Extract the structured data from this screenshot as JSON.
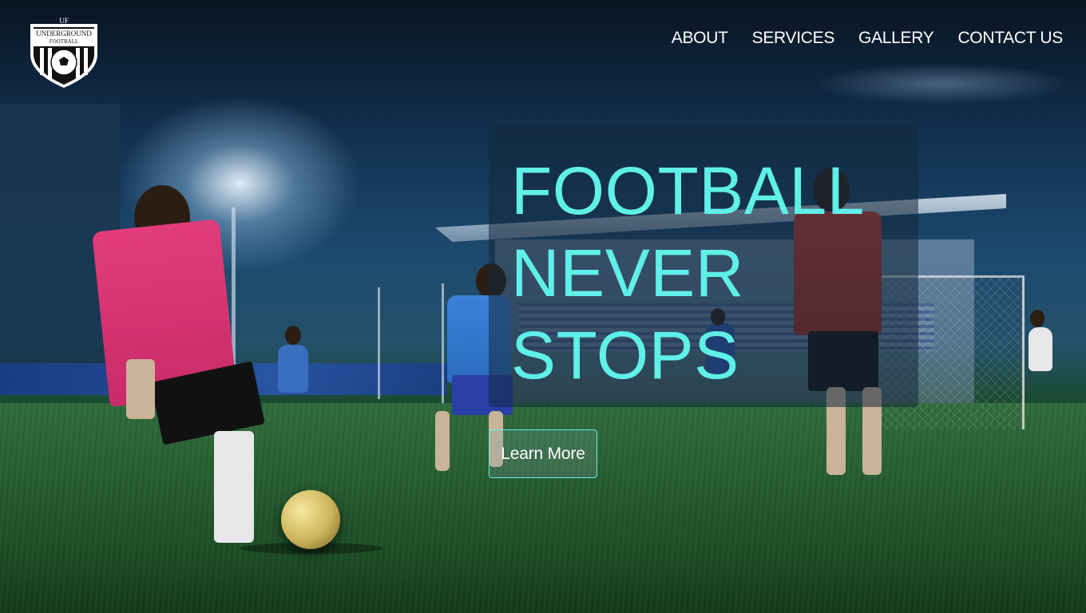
{
  "brand": {
    "logo_text_line1": "UNDERGROUND",
    "logo_text_line2": "FOOTBALL",
    "logo_monogram": "UF",
    "logo_icon": "soccer-ball-shield-icon"
  },
  "nav": {
    "items": [
      {
        "label": "ABOUT"
      },
      {
        "label": "SERVICES"
      },
      {
        "label": "GALLERY"
      },
      {
        "label": "CONTACT US"
      }
    ]
  },
  "hero": {
    "headline_lines": [
      "FOOTBALL",
      "NEVER",
      "STOPS"
    ],
    "cta_label": "Learn More",
    "accent_color": "#5ff0e8",
    "background": "night football pitch with players under floodlights"
  }
}
